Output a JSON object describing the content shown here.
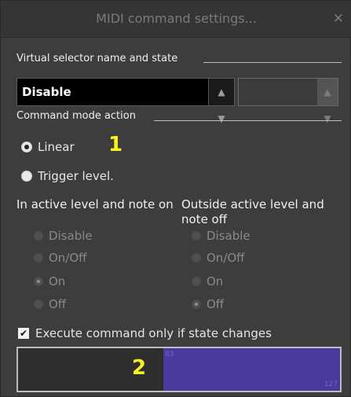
{
  "window": {
    "title": "MIDI command settings...",
    "close_glyph": "✕"
  },
  "virtual_selector": {
    "label": "Virtual selector name and state",
    "selected": "Disable",
    "spin_glyph": "▲\n▼",
    "secondary_value": "",
    "secondary_spin_glyph": "▲\n▼"
  },
  "command_mode": {
    "label": "Command mode action",
    "options": [
      {
        "label": "Linear",
        "selected": true
      },
      {
        "label": "Trigger level.",
        "selected": false
      }
    ],
    "annotation_1": "1"
  },
  "active_column": {
    "heading": "In active level and note on",
    "options": [
      {
        "label": "Disable",
        "selected": false
      },
      {
        "label": "On/Off",
        "selected": false
      },
      {
        "label": "On",
        "selected": true
      },
      {
        "label": "Off",
        "selected": false
      }
    ]
  },
  "outside_column": {
    "heading": "Outside active level and note off",
    "options": [
      {
        "label": "Disable",
        "selected": false
      },
      {
        "label": "On/Off",
        "selected": false
      },
      {
        "label": "On",
        "selected": false
      },
      {
        "label": "Off",
        "selected": true
      }
    ]
  },
  "execute_option": {
    "label": "Execute command only if state changes",
    "checked": true,
    "check_glyph": "✔"
  },
  "range_panel": {
    "annotation_2": "2",
    "low_value": "83",
    "high_value": "127",
    "fill_color": "#4a3a9e"
  }
}
